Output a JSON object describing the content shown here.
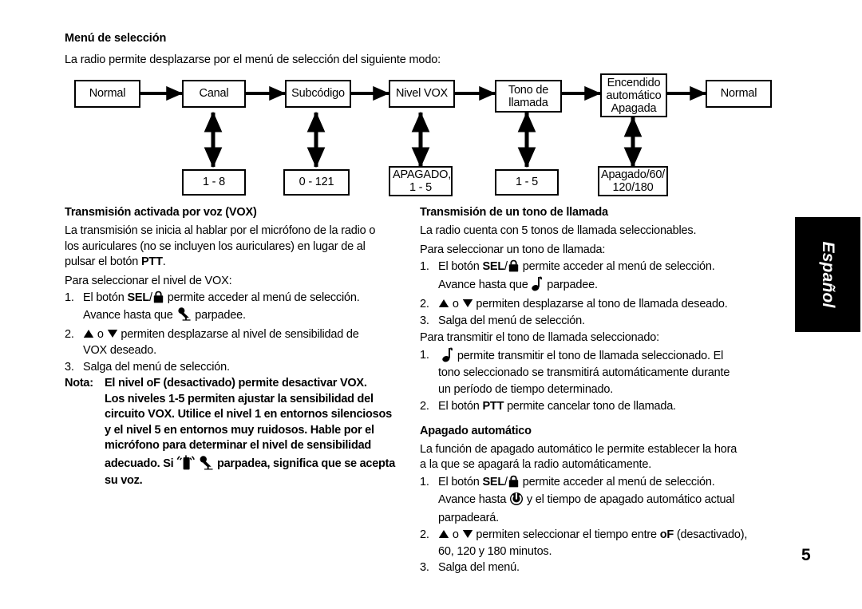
{
  "document": {
    "language_tab": "Español",
    "page_number": "5"
  },
  "menu_section": {
    "title": "Menú de selección",
    "intro": "La radio permite desplazarse por el menú de selección del siguiente modo:"
  },
  "flow_diagram": {
    "top_boxes": [
      {
        "label": "Normal"
      },
      {
        "label": "Canal"
      },
      {
        "label": "Subcódigo"
      },
      {
        "label": "Nivel VOX"
      },
      {
        "label_line1": "Tono de",
        "label_line2": "llamada"
      },
      {
        "label_line1": "Encendido",
        "label_line2": "automático",
        "label_line3": "Apagada"
      },
      {
        "label": "Normal"
      }
    ],
    "bottom_boxes": [
      {
        "label": "1 - 8"
      },
      {
        "label": "0 - 121"
      },
      {
        "label_line1": "APAGADO,",
        "label_line2": "1 - 5"
      },
      {
        "label": "1 - 5"
      },
      {
        "label_line1": "Apagado/60/",
        "label_line2": "120/180"
      }
    ]
  },
  "vox_section": {
    "title": "Transmisión activada por voz (VOX)",
    "paragraph1_a": "La transmisión se inicia al hablar por el micrófono de la radio o",
    "paragraph1_b": "los auriculares (no se incluyen los auriculares) en lugar de al",
    "paragraph1_c_pre": "pulsar el botón ",
    "paragraph1_c_bold": "PTT",
    "paragraph1_c_post": ".",
    "paragraph2": "Para seleccionar el nivel de VOX:",
    "step1_num": "1.",
    "step1_pre": "El botón ",
    "step1_bold": "SEL",
    "step1_slash": "/",
    "step1_post": " permite acceder al menú de selección.",
    "step1_sub_pre": "Avance hasta que ",
    "step1_sub_post": " parpadee.",
    "step2_num": "2.",
    "step2_mid": " o ",
    "step2_post": " permiten desplazarse al nivel de sensibilidad de",
    "step2_line2": "VOX deseado.",
    "step3_num": "3.",
    "step3_text": "Salga del menú de selección.",
    "note_label": "Nota:",
    "note_line1": "El nivel oF (desactivado) permite desactivar VOX.",
    "note_line2": "Los niveles 1-5 permiten ajustar la sensibilidad del",
    "note_line3": "circuito VOX. Utilice el nivel 1 en entornos silenciosos",
    "note_line4": "y el nivel 5 en entornos muy ruidosos. Hable por el",
    "note_line5": "micrófono para determinar el nivel de sensibilidad",
    "note_line6_pre": "adecuado. Si ",
    "note_line6_post": " parpadea, significa que se acepta",
    "note_line7": "su voz."
  },
  "call_tone_section": {
    "title": "Transmisión de un tono de llamada",
    "paragraph1": "La radio cuenta con 5 tonos de llamada seleccionables.",
    "paragraph2": "Para seleccionar un tono de llamada:",
    "step1_num": "1.",
    "step1_pre": "El botón ",
    "step1_bold": "SEL",
    "step1_slash": "/",
    "step1_post": " permite acceder al menú de selección.",
    "step1_sub_pre": "Avance hasta que ",
    "step1_sub_post": " parpadee.",
    "step2_num": "2.",
    "step2_mid": " o ",
    "step2_post": " permiten desplazarse al tono de llamada deseado.",
    "step3_num": "3.",
    "step3_text": "Salga del menú de selección.",
    "paragraph3": "Para transmitir el tono de llamada seleccionado:",
    "tstep1_num": "1.",
    "tstep1_post": " permite transmitir el tono de llamada seleccionado. El",
    "tstep1_line2": "tono seleccionado se transmitirá automáticamente durante",
    "tstep1_line3": "un período de tiempo determinado.",
    "tstep2_num": "2.",
    "tstep2_pre": "El botón ",
    "tstep2_bold": "PTT",
    "tstep2_post": " permite cancelar tono de llamada."
  },
  "auto_off_section": {
    "title": "Apagado automático",
    "paragraph1_a": "La función de apagado automático le permite establecer la hora",
    "paragraph1_b": "a la que se apagará la radio automáticamente.",
    "step1_num": "1.",
    "step1_pre": "El botón ",
    "step1_bold": "SEL",
    "step1_slash": "/",
    "step1_post": " permite acceder al menú de selección.",
    "step1_sub_pre": "Avance hasta ",
    "step1_sub_post": " y el tiempo de apagado automático actual",
    "step1_sub_line2": "parpadeará.",
    "step2_num": "2.",
    "step2_mid": " o ",
    "step2_post_pre": " permiten seleccionar el tiempo entre ",
    "step2_post_bold": "oF",
    "step2_post_end": " (desactivado),",
    "step2_line2": "60, 120 y 180 minutos.",
    "step3_num": "3.",
    "step3_text": "Salga del menú."
  },
  "icons": {
    "lock": "lock-icon",
    "microphone": "microphone-icon",
    "radio_transmit": "radio-transmit-icon",
    "music_note": "music-note-icon",
    "power": "power-icon",
    "up_triangle": "▲",
    "down_triangle": "▼"
  },
  "colors": {
    "ink": "#000000",
    "paper": "#ffffff"
  }
}
